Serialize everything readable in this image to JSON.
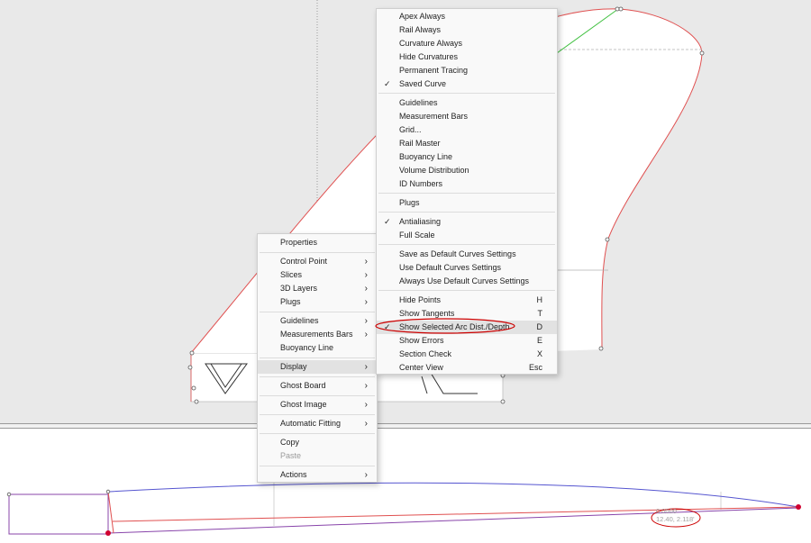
{
  "context_menu": {
    "items": [
      {
        "label": "Properties",
        "submenu": false
      },
      {
        "label": "Control Point",
        "submenu": true
      },
      {
        "label": "Slices",
        "submenu": true
      },
      {
        "label": "3D Layers",
        "submenu": true
      },
      {
        "label": "Plugs",
        "submenu": true
      },
      {
        "label": "Guidelines",
        "submenu": true
      },
      {
        "label": "Measurements Bars",
        "submenu": true
      },
      {
        "label": "Buoyancy Line",
        "submenu": false
      },
      {
        "label": "Display",
        "submenu": true,
        "highlighted": true
      },
      {
        "label": "Ghost Board",
        "submenu": true
      },
      {
        "label": "Ghost Image",
        "submenu": true
      },
      {
        "label": "Automatic Fitting",
        "submenu": true
      },
      {
        "label": "Copy",
        "submenu": false
      },
      {
        "label": "Paste",
        "submenu": false,
        "disabled": true
      },
      {
        "label": "Actions",
        "submenu": true
      }
    ]
  },
  "display_submenu": {
    "items": [
      {
        "label": "Apex Always"
      },
      {
        "label": "Rail Always"
      },
      {
        "label": "Curvature Always"
      },
      {
        "label": "Hide Curvatures"
      },
      {
        "label": "Permanent Tracing"
      },
      {
        "label": "Saved Curve",
        "checked": true
      },
      {
        "label": "Guidelines"
      },
      {
        "label": "Measurement Bars"
      },
      {
        "label": "Grid..."
      },
      {
        "label": "Rail Master"
      },
      {
        "label": "Buoyancy Line"
      },
      {
        "label": "Volume Distribution"
      },
      {
        "label": "ID Numbers"
      },
      {
        "label": "Plugs"
      },
      {
        "label": "Antialiasing",
        "checked": true
      },
      {
        "label": "Full Scale"
      },
      {
        "label": "Save as Default Curves Settings"
      },
      {
        "label": "Use Default Curves Settings"
      },
      {
        "label": "Always Use Default Curves Settings"
      },
      {
        "label": "Hide Points",
        "shortcut": "H"
      },
      {
        "label": "Show Tangents",
        "shortcut": "T"
      },
      {
        "label": "Show Selected Arc Dist./Depth",
        "shortcut": "D",
        "checked": true,
        "highlighted": true
      },
      {
        "label": "Show Errors",
        "shortcut": "E"
      },
      {
        "label": "Section Check",
        "shortcut": "X"
      },
      {
        "label": "Center View",
        "shortcut": "Esc"
      }
    ]
  },
  "arc_readout": {
    "line1": "0.0000",
    "line2": "12.40, 2.118'"
  },
  "colors": {
    "curve_red": "#e05050",
    "curve_blue": "#5555d0",
    "curve_purple": "#8844aa",
    "tangent_green": "#40c040",
    "annotation_red": "#cc0000"
  }
}
